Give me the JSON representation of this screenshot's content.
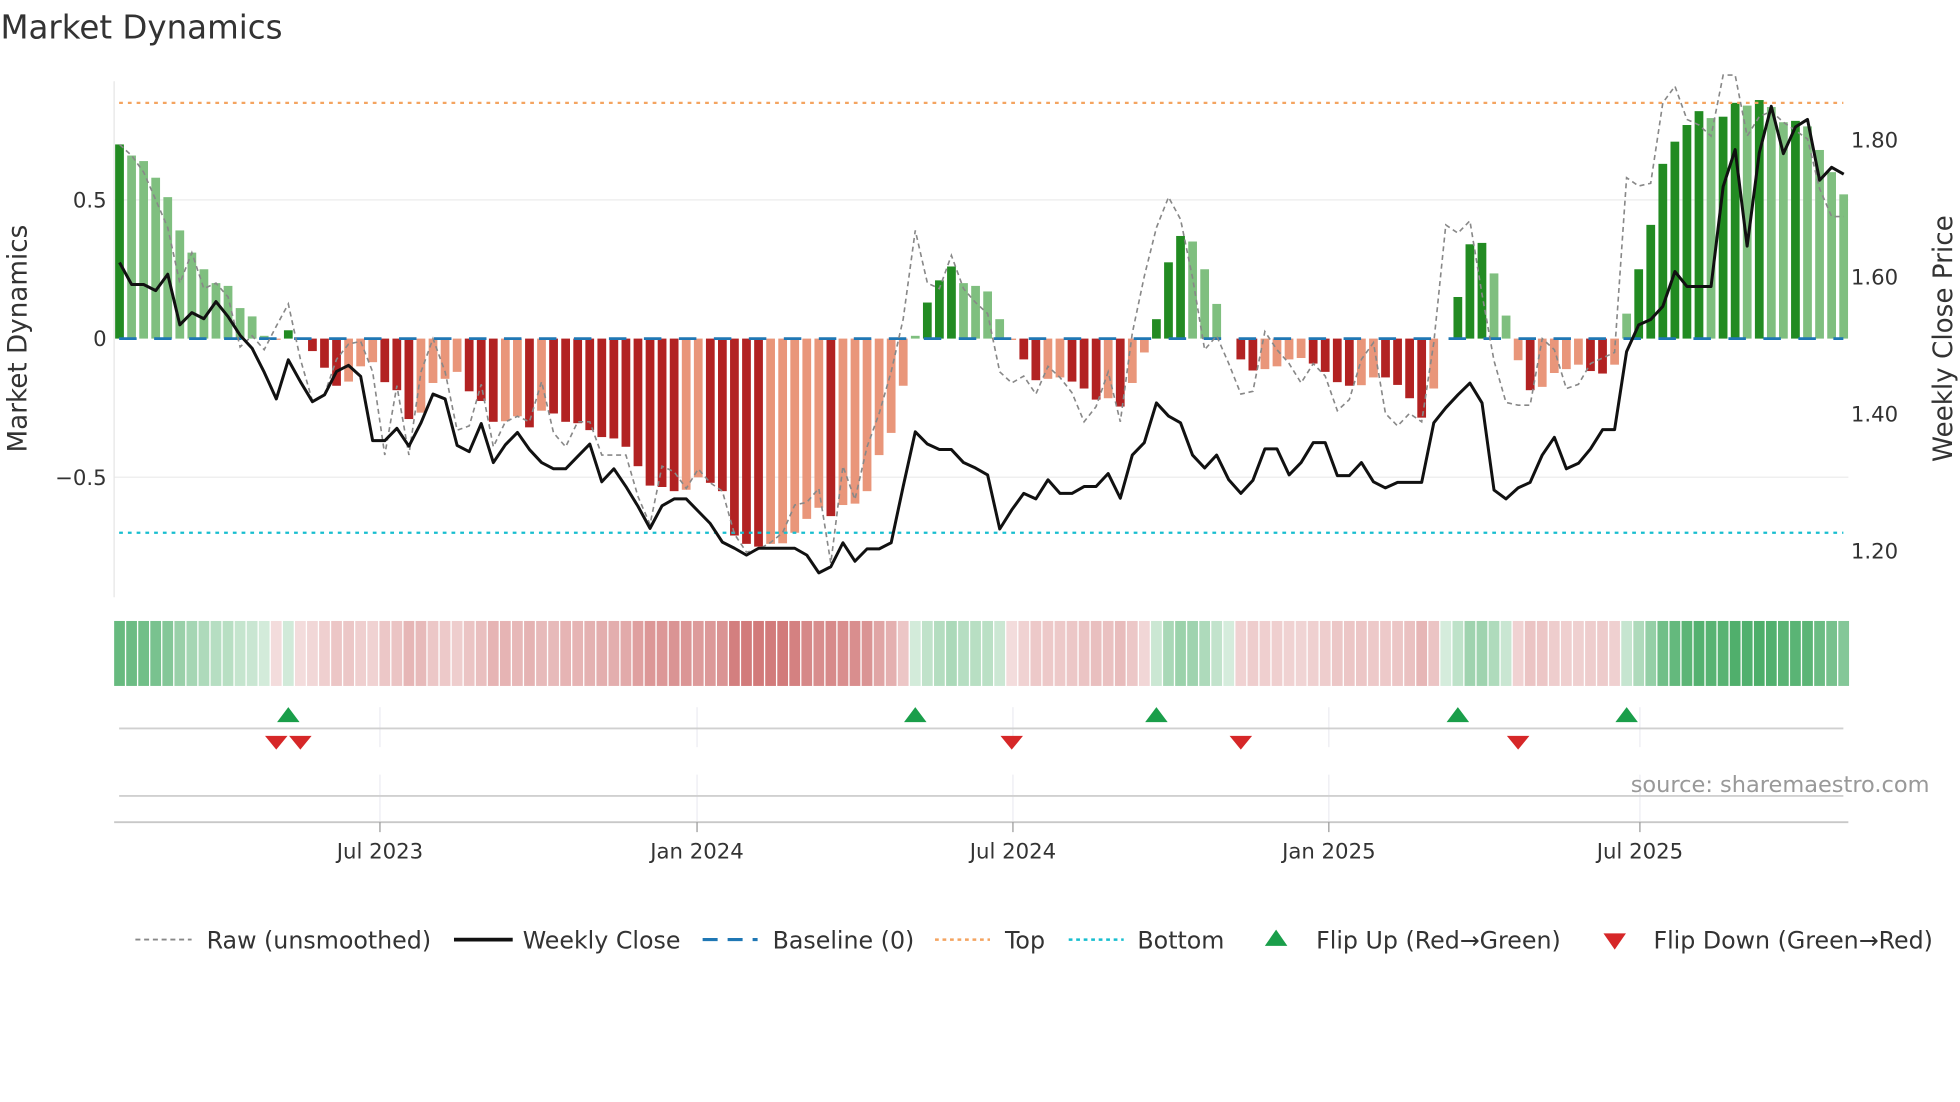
{
  "chart_data": {
    "type": "bar",
    "title": "Market Dynamics",
    "ylabel": "Market Dynamics",
    "y2label": "Weekly Close Price",
    "ylim": [
      -0.95,
      0.93
    ],
    "y2lim": [
      1.12,
      1.89
    ],
    "yticks": [
      {
        "v": 0.5,
        "label": "0.5"
      },
      {
        "v": 0,
        "label": "0"
      },
      {
        "v": -0.5,
        "label": "−0.5"
      }
    ],
    "y2ticks": [
      {
        "v": 1.8,
        "label": "1.80"
      },
      {
        "v": 1.6,
        "label": "1.60"
      },
      {
        "v": 1.4,
        "label": "1.40"
      },
      {
        "v": 1.2,
        "label": "1.20"
      }
    ],
    "xticks": [
      {
        "v": 21.6,
        "label": "Jul 2023"
      },
      {
        "v": 47.9,
        "label": "Jan 2024"
      },
      {
        "v": 74.1,
        "label": "Jul 2024"
      },
      {
        "v": 100.3,
        "label": "Jan 2025"
      },
      {
        "v": 126.1,
        "label": "Jul 2025"
      }
    ],
    "baseline": 0,
    "top": 0.85,
    "bottom": -0.7,
    "colors": {
      "green_dark": "#228b22",
      "green_light": "#7fbf7f",
      "red_dark": "#b22222",
      "red_light": "#e9967a",
      "raw": "#888888",
      "close": "#111111",
      "baseline": "#1f77b4",
      "top": "#f4a460",
      "bottom": "#17becf",
      "flip_up": "#1a9e4a",
      "flip_down": "#d62728"
    },
    "momentum": [
      0.7,
      0.66,
      0.64,
      0.58,
      0.51,
      0.39,
      0.31,
      0.25,
      0.2,
      0.19,
      0.11,
      0.08,
      0.01,
      -0.004,
      0.03,
      -0.004,
      -0.045,
      -0.105,
      -0.17,
      -0.155,
      -0.1,
      -0.085,
      -0.157,
      -0.186,
      -0.29,
      -0.267,
      -0.16,
      -0.145,
      -0.12,
      -0.19,
      -0.225,
      -0.3,
      -0.298,
      -0.28,
      -0.32,
      -0.26,
      -0.27,
      -0.3,
      -0.305,
      -0.33,
      -0.355,
      -0.36,
      -0.39,
      -0.46,
      -0.53,
      -0.535,
      -0.55,
      -0.545,
      -0.5,
      -0.52,
      -0.55,
      -0.71,
      -0.74,
      -0.75,
      -0.74,
      -0.738,
      -0.7,
      -0.65,
      -0.61,
      -0.64,
      -0.6,
      -0.595,
      -0.55,
      -0.42,
      -0.34,
      -0.17,
      0.01,
      0.13,
      0.21,
      0.26,
      0.2,
      0.19,
      0.17,
      0.07,
      -0.005,
      -0.075,
      -0.15,
      -0.145,
      -0.14,
      -0.155,
      -0.18,
      -0.22,
      -0.215,
      -0.245,
      -0.16,
      -0.05,
      0.07,
      0.275,
      0.37,
      0.35,
      0.25,
      0.125,
      0,
      -0.075,
      -0.115,
      -0.11,
      -0.1,
      -0.075,
      -0.07,
      -0.09,
      -0.12,
      -0.157,
      -0.17,
      -0.168,
      -0.14,
      -0.14,
      -0.167,
      -0.215,
      -0.285,
      -0.18,
      0,
      0.15,
      0.34,
      0.345,
      0.235,
      0.083,
      -0.078,
      -0.186,
      -0.174,
      -0.124,
      -0.11,
      -0.094,
      -0.117,
      -0.126,
      -0.094,
      0.09,
      0.25,
      0.41,
      0.63,
      0.71,
      0.77,
      0.82,
      0.795,
      0.8,
      0.85,
      0.84,
      0.86,
      0.835,
      0.78,
      0.785,
      0.765,
      0.68,
      0.6,
      0.52
    ],
    "raw": [
      0.7,
      0.66,
      0.6,
      0.5,
      0.4,
      0.2,
      0.31,
      0.18,
      0.2,
      0.15,
      -0.03,
      0.01,
      -0.04,
      0.045,
      0.125,
      -0.075,
      -0.225,
      -0.2,
      -0.075,
      -0.02,
      -0.01,
      -0.12,
      -0.42,
      -0.17,
      -0.42,
      -0.12,
      0.0,
      -0.12,
      -0.33,
      -0.315,
      -0.165,
      -0.39,
      -0.3,
      -0.28,
      -0.3,
      -0.155,
      -0.34,
      -0.39,
      -0.3,
      -0.3,
      -0.42,
      -0.42,
      -0.42,
      -0.57,
      -0.67,
      -0.46,
      -0.48,
      -0.54,
      -0.47,
      -0.52,
      -0.55,
      -0.705,
      -0.77,
      -0.76,
      -0.735,
      -0.7,
      -0.6,
      -0.59,
      -0.54,
      -0.81,
      -0.46,
      -0.58,
      -0.39,
      -0.27,
      -0.12,
      0.07,
      0.39,
      0.2,
      0.18,
      0.3,
      0.18,
      0.13,
      0.09,
      -0.12,
      -0.16,
      -0.135,
      -0.2,
      -0.1,
      -0.14,
      -0.195,
      -0.3,
      -0.245,
      -0.12,
      -0.3,
      0.02,
      0.225,
      0.4,
      0.51,
      0.43,
      0.22,
      -0.04,
      0.01,
      -0.09,
      -0.2,
      -0.19,
      0.025,
      -0.04,
      -0.09,
      -0.16,
      -0.09,
      -0.135,
      -0.26,
      -0.22,
      -0.075,
      -0.015,
      -0.27,
      -0.315,
      -0.27,
      -0.3,
      -0.015,
      0.41,
      0.38,
      0.425,
      0.16,
      -0.08,
      -0.23,
      -0.24,
      -0.24,
      0.0,
      -0.04,
      -0.18,
      -0.165,
      -0.09,
      -0.07,
      -0.05,
      0.58,
      0.55,
      0.56,
      0.85,
      0.91,
      0.79,
      0.77,
      0.73,
      0.95,
      0.95,
      0.73,
      0.8,
      0.82,
      0.78,
      0.75,
      0.72,
      0.54,
      0.44,
      0.44
    ],
    "close": [
      1.621,
      1.589,
      1.589,
      1.58,
      1.604,
      1.53,
      1.548,
      1.539,
      1.564,
      1.542,
      1.515,
      1.496,
      1.461,
      1.422,
      1.479,
      1.447,
      1.418,
      1.428,
      1.462,
      1.471,
      1.455,
      1.361,
      1.361,
      1.379,
      1.353,
      1.387,
      1.429,
      1.422,
      1.354,
      1.345,
      1.386,
      1.329,
      1.355,
      1.373,
      1.348,
      1.329,
      1.32,
      1.32,
      1.338,
      1.356,
      1.301,
      1.32,
      1.294,
      1.265,
      1.233,
      1.266,
      1.276,
      1.276,
      1.258,
      1.24,
      1.213,
      1.204,
      1.194,
      1.204,
      1.204,
      1.204,
      1.204,
      1.194,
      1.168,
      1.177,
      1.212,
      1.185,
      1.203,
      1.203,
      1.212,
      1.294,
      1.374,
      1.356,
      1.348,
      1.348,
      1.329,
      1.321,
      1.311,
      1.232,
      1.26,
      1.284,
      1.276,
      1.304,
      1.284,
      1.284,
      1.294,
      1.294,
      1.313,
      1.277,
      1.34,
      1.358,
      1.416,
      1.397,
      1.387,
      1.34,
      1.321,
      1.34,
      1.304,
      1.284,
      1.303,
      1.349,
      1.349,
      1.311,
      1.329,
      1.358,
      1.358,
      1.31,
      1.31,
      1.329,
      1.301,
      1.292,
      1.3,
      1.3,
      1.3,
      1.387,
      1.409,
      1.428,
      1.445,
      1.416,
      1.289,
      1.276,
      1.292,
      1.3,
      1.34,
      1.366,
      1.32,
      1.328,
      1.349,
      1.377,
      1.377,
      1.491,
      1.53,
      1.538,
      1.557,
      1.608,
      1.586,
      1.586,
      1.586,
      1.732,
      1.786,
      1.645,
      1.781,
      1.849,
      1.78,
      1.819,
      1.83,
      1.741,
      1.76,
      1.75
    ],
    "flips_up": [
      14,
      66,
      86,
      111,
      125
    ],
    "flips_down": [
      13,
      15,
      74,
      93,
      116
    ],
    "legend": {
      "placement": "bottom",
      "raw": "Raw (unsmoothed)",
      "close": "Weekly Close",
      "baseline": "Baseline (0)",
      "top": "Top",
      "bottom": "Bottom",
      "flip_up": "Flip Up (Red→Green)",
      "flip_down": "Flip Down (Green→Red)"
    },
    "source": "source: sharemaestro.com"
  }
}
